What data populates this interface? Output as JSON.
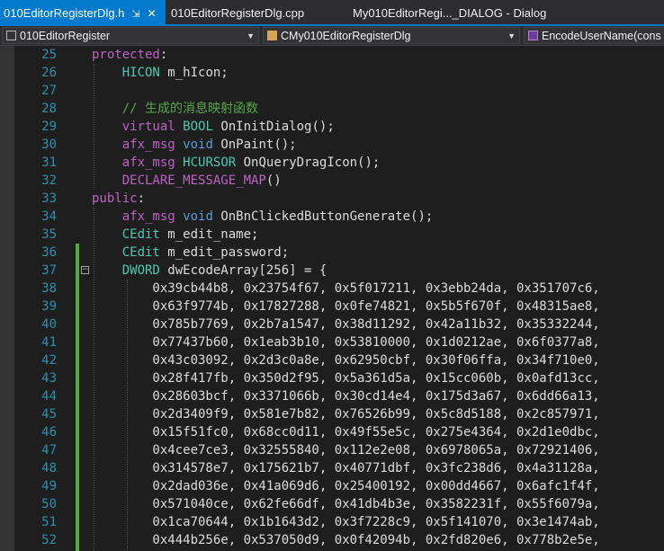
{
  "tabs": [
    {
      "label": "010EditorRegisterDlg.h",
      "pin": "⇲",
      "close": "✕"
    },
    {
      "label": "010EditorRegisterDlg.cpp"
    },
    {
      "label": "My010EditorRegi..._DIALOG - Dialog"
    }
  ],
  "nav": {
    "project": "010EditorRegister",
    "class": "CMy010EditorRegisterDlg",
    "member": "EncodeUserName(cons"
  },
  "lines": [
    {
      "n": "25",
      "t": [
        {
          "c": "mac",
          "v": "protected"
        },
        {
          "c": "",
          "v": ":"
        }
      ]
    },
    {
      "n": "26",
      "t": [
        {
          "c": "",
          "v": "    "
        },
        {
          "c": "typ",
          "v": "HICON"
        },
        {
          "c": "",
          "v": " m_hIcon;"
        }
      ]
    },
    {
      "n": "27",
      "t": []
    },
    {
      "n": "28",
      "t": [
        {
          "c": "",
          "v": "    "
        },
        {
          "c": "cm",
          "v": "// 生成的消息映射函数"
        }
      ]
    },
    {
      "n": "29",
      "t": [
        {
          "c": "",
          "v": "    "
        },
        {
          "c": "mac",
          "v": "virtual"
        },
        {
          "c": "",
          "v": " "
        },
        {
          "c": "typ",
          "v": "BOOL"
        },
        {
          "c": "",
          "v": " OnInitDialog();"
        }
      ]
    },
    {
      "n": "30",
      "t": [
        {
          "c": "",
          "v": "    "
        },
        {
          "c": "mac",
          "v": "afx_msg"
        },
        {
          "c": "",
          "v": " "
        },
        {
          "c": "kw",
          "v": "void"
        },
        {
          "c": "",
          "v": " OnPaint();"
        }
      ]
    },
    {
      "n": "31",
      "t": [
        {
          "c": "",
          "v": "    "
        },
        {
          "c": "mac",
          "v": "afx_msg"
        },
        {
          "c": "",
          "v": " "
        },
        {
          "c": "typ",
          "v": "HCURSOR"
        },
        {
          "c": "",
          "v": " OnQueryDragIcon();"
        }
      ]
    },
    {
      "n": "32",
      "t": [
        {
          "c": "",
          "v": "    "
        },
        {
          "c": "mac",
          "v": "DECLARE_MESSAGE_MAP"
        },
        {
          "c": "",
          "v": "()"
        }
      ]
    },
    {
      "n": "33",
      "t": [
        {
          "c": "mac",
          "v": "public"
        },
        {
          "c": "",
          "v": ":"
        }
      ]
    },
    {
      "n": "34",
      "t": [
        {
          "c": "",
          "v": "    "
        },
        {
          "c": "mac",
          "v": "afx_msg"
        },
        {
          "c": "",
          "v": " "
        },
        {
          "c": "kw",
          "v": "void"
        },
        {
          "c": "",
          "v": " OnBnClickedButtonGenerate();"
        }
      ]
    },
    {
      "n": "35",
      "t": [
        {
          "c": "",
          "v": "    "
        },
        {
          "c": "typ",
          "v": "CEdit"
        },
        {
          "c": "",
          "v": " m_edit_name;"
        }
      ]
    },
    {
      "n": "36",
      "t": [
        {
          "c": "",
          "v": "    "
        },
        {
          "c": "typ",
          "v": "CEdit"
        },
        {
          "c": "",
          "v": " m_edit_password;"
        }
      ]
    },
    {
      "n": "37",
      "t": [
        {
          "c": "",
          "v": "    "
        },
        {
          "c": "typ",
          "v": "DWORD"
        },
        {
          "c": "",
          "v": " dwEcodeArray[256] = {"
        }
      ]
    },
    {
      "n": "38",
      "t": [
        {
          "c": "",
          "v": "        0x39cb44b8, 0x23754f67, 0x5f017211, 0x3ebb24da, 0x351707c6,"
        }
      ]
    },
    {
      "n": "39",
      "t": [
        {
          "c": "",
          "v": "        0x63f9774b, 0x17827288, 0x0fe74821, 0x5b5f670f, 0x48315ae8,"
        }
      ]
    },
    {
      "n": "40",
      "t": [
        {
          "c": "",
          "v": "        0x785b7769, 0x2b7a1547, 0x38d11292, 0x42a11b32, 0x35332244,"
        }
      ]
    },
    {
      "n": "41",
      "t": [
        {
          "c": "",
          "v": "        0x77437b60, 0x1eab3b10, 0x53810000, 0x1d0212ae, 0x6f0377a8,"
        }
      ]
    },
    {
      "n": "42",
      "t": [
        {
          "c": "",
          "v": "        0x43c03092, 0x2d3c0a8e, 0x62950cbf, 0x30f06ffa, 0x34f710e0,"
        }
      ]
    },
    {
      "n": "43",
      "t": [
        {
          "c": "",
          "v": "        0x28f417fb, 0x350d2f95, 0x5a361d5a, 0x15cc060b, 0x0afd13cc,"
        }
      ]
    },
    {
      "n": "44",
      "t": [
        {
          "c": "",
          "v": "        0x28603bcf, 0x3371066b, 0x30cd14e4, 0x175d3a67, 0x6dd66a13,"
        }
      ]
    },
    {
      "n": "45",
      "t": [
        {
          "c": "",
          "v": "        0x2d3409f9, 0x581e7b82, 0x76526b99, 0x5c8d5188, 0x2c857971,"
        }
      ]
    },
    {
      "n": "46",
      "t": [
        {
          "c": "",
          "v": "        0x15f51fc0, 0x68cc0d11, 0x49f55e5c, 0x275e4364, 0x2d1e0dbc,"
        }
      ]
    },
    {
      "n": "47",
      "t": [
        {
          "c": "",
          "v": "        0x4cee7ce3, 0x32555840, 0x112e2e08, 0x6978065a, 0x72921406,"
        }
      ]
    },
    {
      "n": "48",
      "t": [
        {
          "c": "",
          "v": "        0x314578e7, 0x175621b7, 0x40771dbf, 0x3fc238d6, 0x4a31128a,"
        }
      ]
    },
    {
      "n": "49",
      "t": [
        {
          "c": "",
          "v": "        0x2dad036e, 0x41a069d6, 0x25400192, 0x00dd4667, 0x6afc1f4f,"
        }
      ]
    },
    {
      "n": "50",
      "t": [
        {
          "c": "",
          "v": "        0x571040ce, 0x62fe66df, 0x41db4b3e, 0x3582231f, 0x55f6079a,"
        }
      ]
    },
    {
      "n": "51",
      "t": [
        {
          "c": "",
          "v": "        0x1ca70644, 0x1b1643d2, 0x3f7228c9, 0x5f141070, 0x3e1474ab,"
        }
      ]
    },
    {
      "n": "52",
      "t": [
        {
          "c": "",
          "v": "        0x444b256e, 0x537050d9, 0x0f42094b, 0x2fd820e6, 0x778b2e5e,"
        }
      ]
    }
  ],
  "colors": {
    "accent": "#007acc",
    "keyword": "#569cd6",
    "type": "#4ec9b0",
    "macro": "#bd63c5",
    "comment": "#57a64a",
    "linenumber": "#2b91af"
  }
}
